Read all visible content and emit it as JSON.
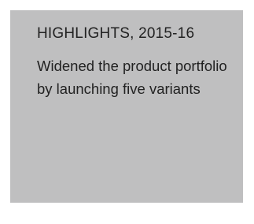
{
  "card": {
    "heading": "HIGHLIGHTS, 2015-16",
    "body": "Widened the product portfolio by launching five variants",
    "background_color": "#bfbfc0",
    "text_color": "#222222"
  }
}
